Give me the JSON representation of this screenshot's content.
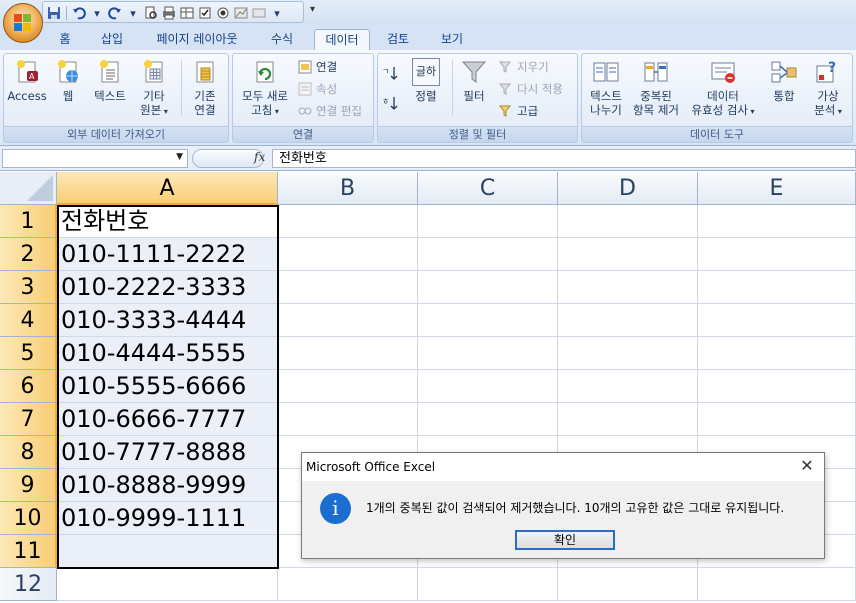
{
  "tabs": [
    {
      "label": "홈"
    },
    {
      "label": "삽입"
    },
    {
      "label": "페이지 레이아웃"
    },
    {
      "label": "수식"
    },
    {
      "label": "데이터"
    },
    {
      "label": "검토"
    },
    {
      "label": "보기"
    }
  ],
  "active_tab": "데이터",
  "ribbon": {
    "external": {
      "group_label": "외부 데이터 가져오기",
      "access": "Access",
      "web": "웹",
      "text": "텍스트",
      "other_line1": "기타",
      "other_line2": "원본",
      "existing_line1": "기존",
      "existing_line2": "연결"
    },
    "connections": {
      "group_label": "연결",
      "refresh_line1": "모두 새로",
      "refresh_line2": "고침",
      "connections": "연결",
      "properties": "속성",
      "edit_links": "연결 편집"
    },
    "sort_filter": {
      "group_label": "정렬 및 필터",
      "sort": "정렬",
      "filter": "필터",
      "clear": "지우기",
      "reapply": "다시 적용",
      "advanced": "고급",
      "sort_icon_text": "글하"
    },
    "data_tools": {
      "group_label": "데이터 도구",
      "text_to_cols_line1": "텍스트",
      "text_to_cols_line2": "나누기",
      "remove_dup_line1": "중복된",
      "remove_dup_line2": "항목 제거",
      "validation_line1": "데이터",
      "validation_line2": "유효성 검사",
      "consolidate": "통합",
      "whatif_line1": "가상",
      "whatif_line2": "분석"
    }
  },
  "formula_bar": {
    "name_box": "",
    "fx_label": "fx",
    "content": "전화번호"
  },
  "sheet": {
    "columns": [
      "A",
      "B",
      "C",
      "D",
      "E"
    ],
    "rows": [
      "1",
      "2",
      "3",
      "4",
      "5",
      "6",
      "7",
      "8",
      "9",
      "10",
      "11",
      "12"
    ],
    "col_a_values": [
      "전화번호",
      "010-1111-2222",
      "010-2222-3333",
      "010-3333-4444",
      "010-4444-5555",
      "010-5555-6666",
      "010-6666-7777",
      "010-7777-8888",
      "010-8888-9999",
      "010-9999-1111",
      "",
      ""
    ]
  },
  "dialog": {
    "title": "Microsoft Office Excel",
    "close": "✕",
    "icon": "i",
    "message": "1개의 중복된 값이 검색되어 제거했습니다. 10개의 고유한 값은 그대로 유지됩니다.",
    "ok": "확인"
  },
  "colors": {
    "ribbon_bg": "#dbe6f4",
    "selected_header": "#f8ce76",
    "dialog_accent": "#1a6ed0"
  }
}
